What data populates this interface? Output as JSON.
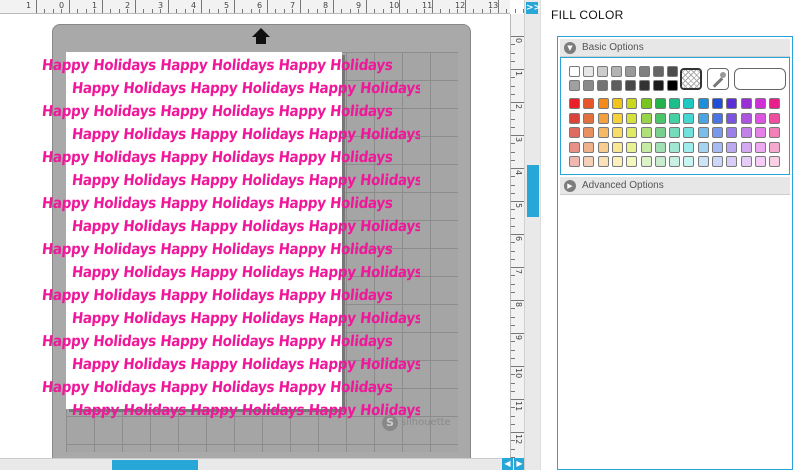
{
  "ruler": {
    "top_numbers": [
      "1",
      "0",
      "1",
      "2",
      "3",
      "4",
      "5",
      "6",
      "7",
      "8",
      "9",
      "10",
      "11",
      "12",
      "13"
    ],
    "side_numbers": [
      "0",
      "1",
      "2",
      "3",
      "4",
      "5",
      "6",
      "7",
      "8",
      "9",
      "10",
      "11",
      "12"
    ]
  },
  "panel_toggle_label": ">>",
  "scroll_left_label": "◀",
  "scroll_right_label": "▶",
  "mat": {
    "pattern_text": "Happy Holidays Happy Holidays Happy Holidays",
    "pattern_color": "#f0179a",
    "brand_logo": "S",
    "brand_name": "silhouette"
  },
  "panel": {
    "title": "FILL COLOR",
    "basic_options_label": "Basic Options",
    "advanced_options_label": "Advanced Options",
    "accent_color": "#29a3d6"
  },
  "palette": {
    "gray_row1": [
      "#ffffff",
      "#e6e6e6",
      "#cccccc",
      "#b3b3b3",
      "#999999",
      "#808080",
      "#666666",
      "#4d4d4d"
    ],
    "gray_row2": [
      "#a0a0a0",
      "#8a8a8a",
      "#747474",
      "#5e5e5e",
      "#484848",
      "#323232",
      "#1c1c1c",
      "#000000"
    ],
    "color_rows": [
      [
        "#e8202a",
        "#e8552a",
        "#f28a1e",
        "#f0c419",
        "#c9d81e",
        "#79c51f",
        "#24b24b",
        "#1ebd8c",
        "#1ec9c3",
        "#1e8fd9",
        "#1e4fd9",
        "#5b2fd6",
        "#9a2fd6",
        "#cf2fd6",
        "#e81f8a"
      ],
      [
        "#d9443a",
        "#e07040",
        "#f3a040",
        "#f5d23b",
        "#d5e23b",
        "#96d44a",
        "#4cc46a",
        "#45d0a4",
        "#45d7d1",
        "#4aa6e3",
        "#4a73e3",
        "#7b55e0",
        "#ae55e0",
        "#dc55e0",
        "#ee4f9f"
      ],
      [
        "#e06a60",
        "#e89060",
        "#f5b864",
        "#f7dd67",
        "#e0ea67",
        "#aee177",
        "#78d28e",
        "#73dcbb",
        "#72e2dd",
        "#79bdeb",
        "#7997eb",
        "#9c80e9",
        "#c280e9",
        "#e680e9",
        "#f27fb8"
      ],
      [
        "#e99088",
        "#efb08c",
        "#f8cd90",
        "#f9e795",
        "#eaf295",
        "#c6eba3",
        "#a2e0b3",
        "#a0e7d1",
        "#a0ecea",
        "#a6d3f1",
        "#a6bbf1",
        "#bca9f0",
        "#d5a9f0",
        "#efa9f0",
        "#f6a8cf"
      ],
      [
        "#f1b8b2",
        "#f5cfb6",
        "#fbe1ba",
        "#fcf0be",
        "#f3f8be",
        "#dcf3c8",
        "#c9eccf",
        "#c8f0e3",
        "#c8f4f2",
        "#cde4f7",
        "#cdd7f7",
        "#d8cdf7",
        "#e6cdf7",
        "#f6cdf7",
        "#fad0e4"
      ]
    ]
  }
}
